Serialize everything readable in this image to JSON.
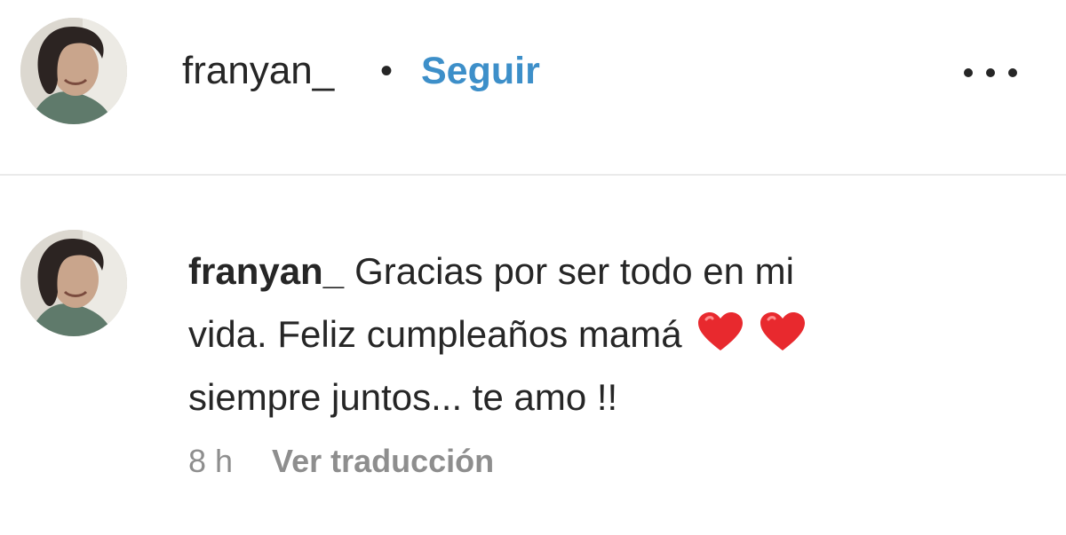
{
  "post_header": {
    "username": "franyan_",
    "separator": "•",
    "follow_label": "Seguir",
    "more_icon": "more-options-icon"
  },
  "comment": {
    "username": "franyan_",
    "line1": "Gracias por ser todo en mi",
    "line2": "vida. Feliz cumpleaños mamá",
    "line3": "siempre juntos... te amo !!",
    "emoji": "red-heart-icon",
    "time": "8 h",
    "translate_label": "Ver traducción"
  },
  "colors": {
    "link_blue": "#3d8fc9",
    "text": "#262626",
    "muted": "#8e8e8e",
    "heart_red": "#e8292e"
  }
}
